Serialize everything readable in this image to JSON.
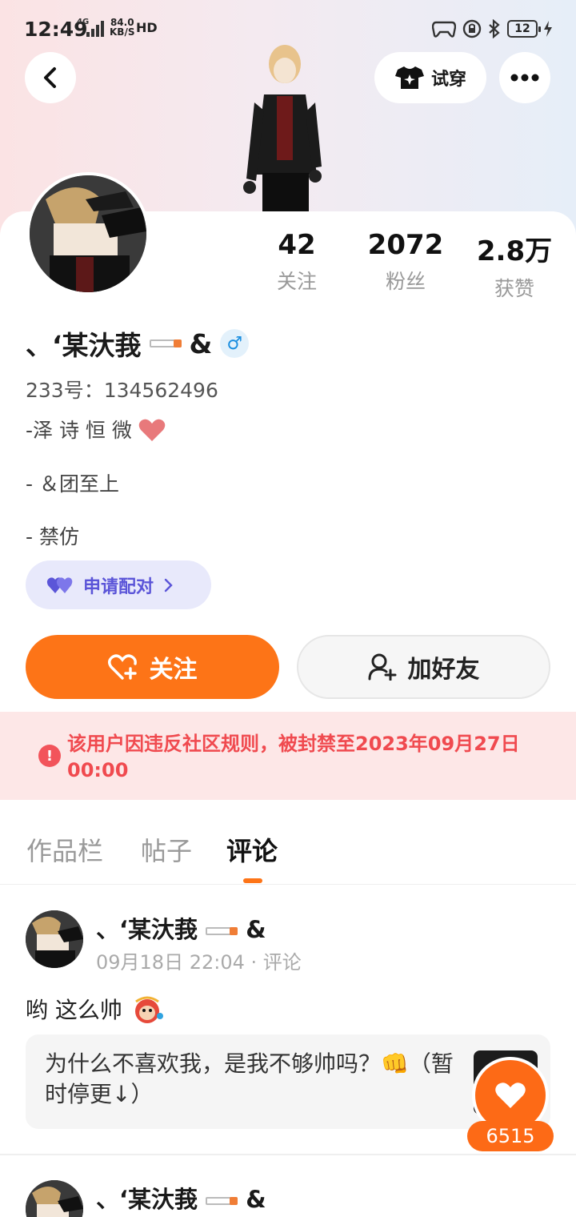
{
  "status_bar": {
    "time": "12:49",
    "network": "4G",
    "speed_value": "84.0",
    "speed_unit": "KB/S",
    "hd": "HD",
    "battery": "12"
  },
  "header": {
    "try_on_label": "试穿"
  },
  "stats": [
    {
      "value": "42",
      "label": "关注"
    },
    {
      "value": "2072",
      "label": "粉丝"
    },
    {
      "value": "2.8万",
      "label": "获赞"
    }
  ],
  "profile": {
    "name": "、‘某汏莪",
    "name_suffix": "&",
    "gender_symbol": "♂",
    "uid": "233号：134562496",
    "bio_lines": [
      "-泽 诗 恒 微",
      "- ＆团至上",
      "- 禁仿"
    ],
    "pair_label": "申请配对"
  },
  "actions": {
    "follow_label": "关注",
    "add_friend_label": "加好友"
  },
  "ban_notice": {
    "text": "该用户因违反社区规则，被封禁至2023年09月27日 00:00"
  },
  "tabs": [
    {
      "label": "作品栏"
    },
    {
      "label": "帖子"
    },
    {
      "label": "评论",
      "active": true
    }
  ],
  "comments": [
    {
      "author": "、‘某汏莪",
      "author_suffix": "&",
      "meta": "09月18日 22:04 · 评论",
      "text": "哟 这么帅",
      "quote": "为什么不喜欢我，是我不够帅吗？👊（暂时停更↓）"
    },
    {
      "author": "、‘某汏莪",
      "author_suffix": "&"
    }
  ],
  "like_fab": {
    "count": "6515"
  },
  "colors": {
    "accent": "#fd7417",
    "ban_text": "#f04a4f",
    "pair_text": "#5b55d8"
  }
}
